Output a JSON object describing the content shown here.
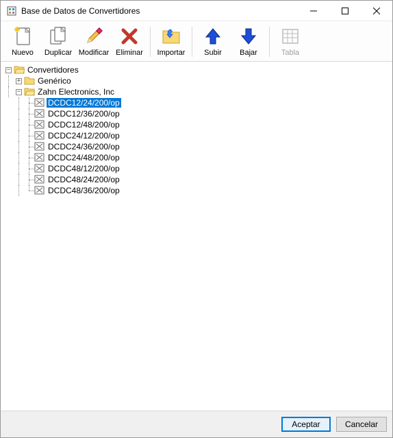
{
  "window": {
    "title": "Base de Datos de Convertidores"
  },
  "toolbar": {
    "nuevo": "Nuevo",
    "duplicar": "Duplicar",
    "modificar": "Modificar",
    "eliminar": "Eliminar",
    "importar": "Importar",
    "subir": "Subir",
    "bajar": "Bajar",
    "tabla": "Tabla"
  },
  "tree": {
    "root": "Convertidores",
    "children": [
      {
        "label": "Genérico",
        "expanded": false
      },
      {
        "label": "Zahn Electronics, Inc",
        "expanded": true,
        "items": [
          "DCDC12/24/200/op",
          "DCDC12/36/200/op",
          "DCDC12/48/200/op",
          "DCDC24/12/200/op",
          "DCDC24/36/200/op",
          "DCDC24/48/200/op",
          "DCDC48/12/200/op",
          "DCDC48/24/200/op",
          "DCDC48/36/200/op"
        ],
        "selectedIndex": 0
      }
    ]
  },
  "footer": {
    "accept": "Aceptar",
    "cancel": "Cancelar"
  }
}
